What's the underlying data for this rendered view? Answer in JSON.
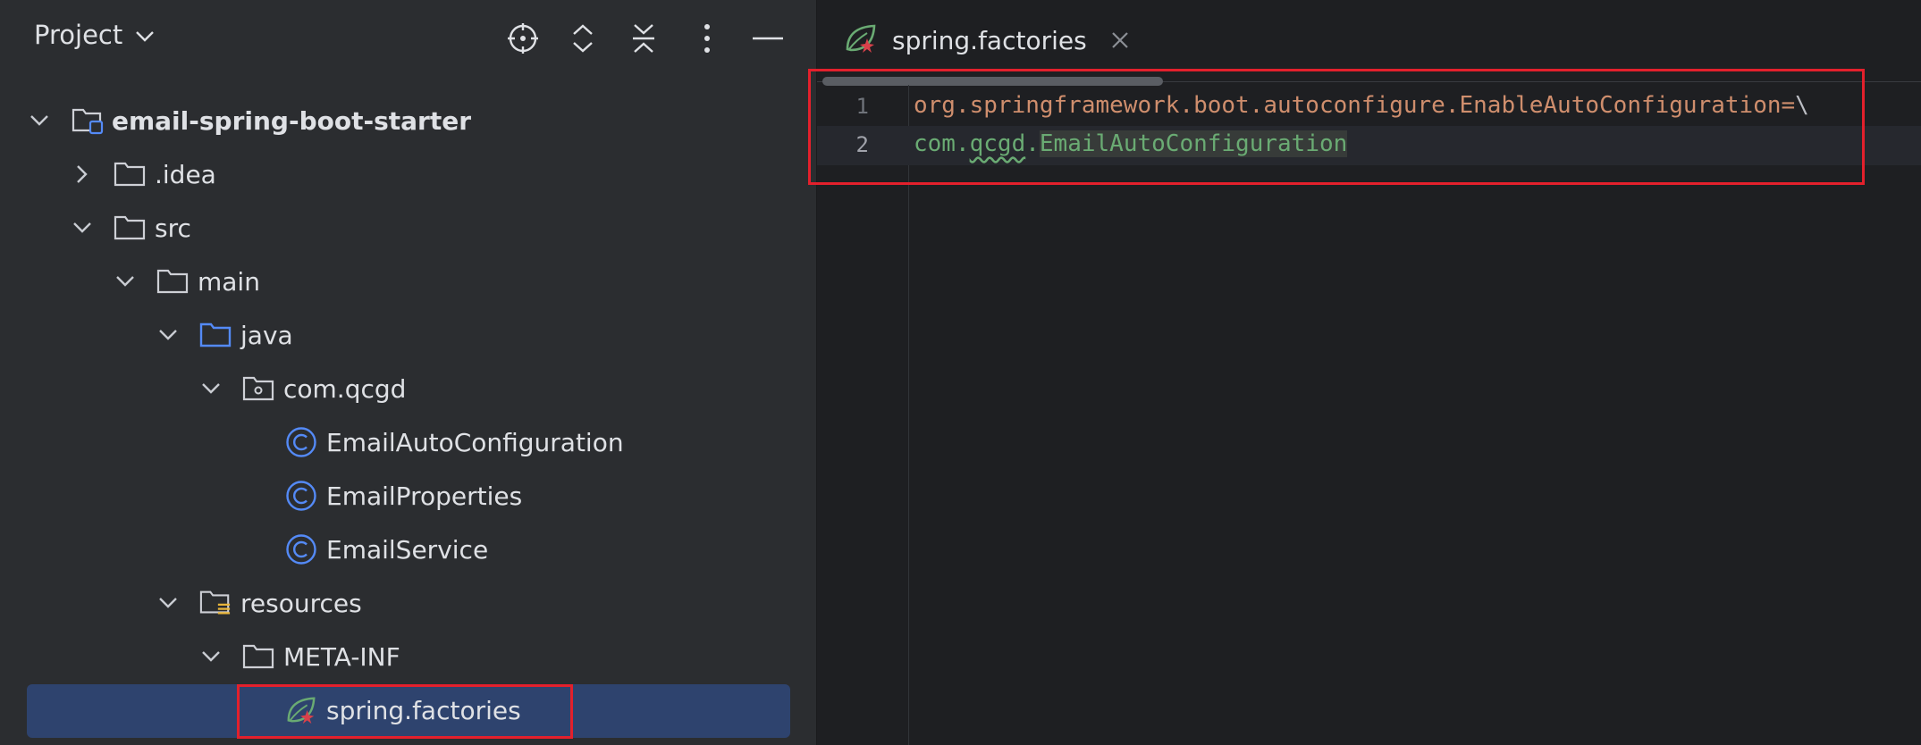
{
  "project_panel": {
    "title": "Project",
    "header_icons": [
      "locate-icon",
      "expand-all-icon",
      "collapse-all-icon",
      "more-options-icon",
      "minimize-icon"
    ],
    "tree": [
      {
        "label": "email-spring-boot-starter",
        "icon": "module-folder-icon",
        "expanded": true
      },
      {
        "label": ".idea",
        "icon": "folder-icon",
        "expanded": false
      },
      {
        "label": "src",
        "icon": "folder-icon",
        "expanded": true
      },
      {
        "label": "main",
        "icon": "folder-icon",
        "expanded": true
      },
      {
        "label": "java",
        "icon": "source-folder-icon",
        "expanded": true
      },
      {
        "label": "com.qcgd",
        "icon": "package-icon",
        "expanded": true
      },
      {
        "label": "EmailAutoConfiguration",
        "icon": "class-icon"
      },
      {
        "label": "EmailProperties",
        "icon": "class-icon"
      },
      {
        "label": "EmailService",
        "icon": "class-icon"
      },
      {
        "label": "resources",
        "icon": "resources-folder-icon",
        "expanded": true
      },
      {
        "label": "META-INF",
        "icon": "folder-icon",
        "expanded": true
      },
      {
        "label": "spring.factories",
        "icon": "spring-icon",
        "selected": true
      }
    ]
  },
  "editor": {
    "tab": {
      "label": "spring.factories",
      "icon": "spring-icon"
    },
    "lines": [
      {
        "number": "1",
        "key": "org.springframework.boot.autoconfigure.EnableAutoConfiguration",
        "sep": "=",
        "cont": "\\"
      },
      {
        "number": "2",
        "pkg1": "com.",
        "pkg2": "qcgd",
        "pkg3": ".",
        "cls": "EmailAutoConfiguration"
      }
    ]
  },
  "colors": {
    "panel_bg": "#2b2d30",
    "editor_bg": "#1e1f22",
    "selection": "#2e436e",
    "annotation_box": "#e3202c",
    "key_orange": "#cf8e6d",
    "value_green": "#6aab73",
    "class_icon_blue": "#548af7"
  }
}
